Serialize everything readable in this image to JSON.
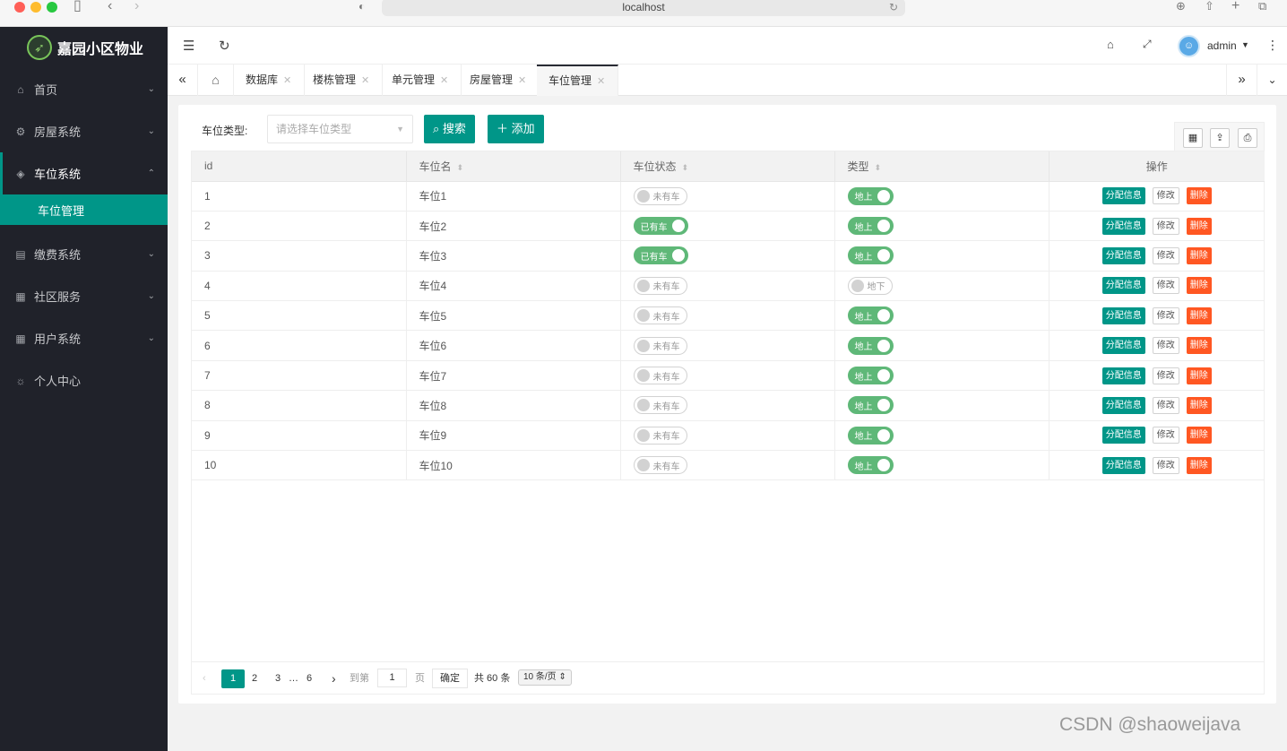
{
  "browser": {
    "url": "localhost"
  },
  "app": {
    "logo_text": "嘉园小区物业"
  },
  "sidebar": {
    "items": [
      {
        "label": "首页"
      },
      {
        "label": "房屋系统"
      },
      {
        "label": "车位系统"
      },
      {
        "label": "缴费系统"
      },
      {
        "label": "社区服务"
      },
      {
        "label": "用户系统"
      },
      {
        "label": "个人中心"
      }
    ],
    "active_sub": "车位管理"
  },
  "header": {
    "username": "admin"
  },
  "tabs": [
    "数据库",
    "楼栋管理",
    "单元管理",
    "房屋管理",
    "车位管理"
  ],
  "filter": {
    "label": "车位类型:",
    "placeholder": "请选择车位类型",
    "search_label": "搜索",
    "add_label": "添加"
  },
  "table": {
    "columns": [
      "id",
      "车位名",
      "车位状态",
      "类型",
      "操作"
    ],
    "rows": [
      {
        "id": "1",
        "name": "车位1",
        "status": "未有车",
        "status_on": false,
        "type": "地上",
        "type_on": true
      },
      {
        "id": "2",
        "name": "车位2",
        "status": "已有车",
        "status_on": true,
        "type": "地上",
        "type_on": true
      },
      {
        "id": "3",
        "name": "车位3",
        "status": "已有车",
        "status_on": true,
        "type": "地上",
        "type_on": true
      },
      {
        "id": "4",
        "name": "车位4",
        "status": "未有车",
        "status_on": false,
        "type": "地下",
        "type_on": false
      },
      {
        "id": "5",
        "name": "车位5",
        "status": "未有车",
        "status_on": false,
        "type": "地上",
        "type_on": true
      },
      {
        "id": "6",
        "name": "车位6",
        "status": "未有车",
        "status_on": false,
        "type": "地上",
        "type_on": true
      },
      {
        "id": "7",
        "name": "车位7",
        "status": "未有车",
        "status_on": false,
        "type": "地上",
        "type_on": true
      },
      {
        "id": "8",
        "name": "车位8",
        "status": "未有车",
        "status_on": false,
        "type": "地上",
        "type_on": true
      },
      {
        "id": "9",
        "name": "车位9",
        "status": "未有车",
        "status_on": false,
        "type": "地上",
        "type_on": true
      },
      {
        "id": "10",
        "name": "车位10",
        "status": "未有车",
        "status_on": false,
        "type": "地上",
        "type_on": true
      }
    ],
    "actions": {
      "assign": "分配信息",
      "edit": "修改",
      "delete": "删除"
    }
  },
  "pagination": {
    "pages": [
      "1",
      "2",
      "3",
      "…",
      "6"
    ],
    "current": "1",
    "goto_label": "到第",
    "goto_value": "1",
    "page_unit": "页",
    "confirm": "确定",
    "total": "共 60 条",
    "page_size": "10 条/页"
  },
  "watermark": "CSDN @shaoweijava",
  "colors": {
    "primary": "#009688",
    "sidebar": "#20222a",
    "switch_on": "#5fb878",
    "danger": "#ff5722"
  }
}
